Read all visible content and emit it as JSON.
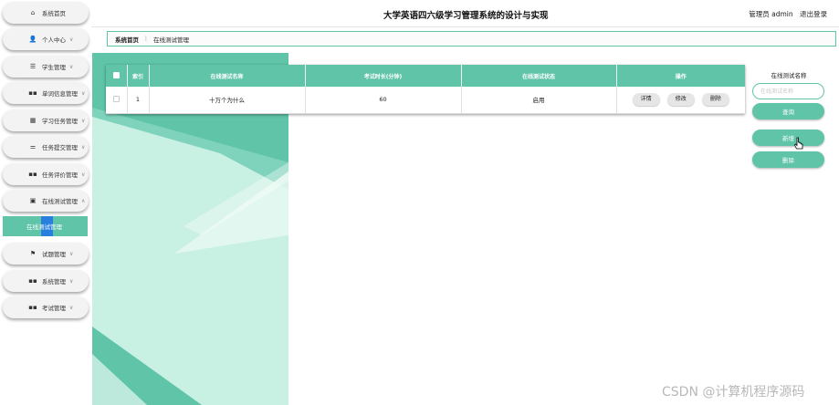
{
  "header": {
    "title": "大学英语四六级学习管理系统的设计与实现",
    "user_label": "管理员 admin",
    "logout_label": "退出登录"
  },
  "sidebar": {
    "items": [
      {
        "icon": "home-icon",
        "icon_glyph": "⌂",
        "label": "系统首页",
        "chevron": ""
      },
      {
        "icon": "user-icon",
        "icon_glyph": "👤",
        "label": "个人中心",
        "chevron": "∨"
      },
      {
        "icon": "list-icon",
        "icon_glyph": "☰",
        "label": "学生管理",
        "chevron": "∨"
      },
      {
        "icon": "grid-icon",
        "icon_glyph": "▪▪",
        "label": "单词信息管理",
        "chevron": "∨"
      },
      {
        "icon": "table-icon",
        "icon_glyph": "▦",
        "label": "学习任务管理",
        "chevron": "∨"
      },
      {
        "icon": "sliders-icon",
        "icon_glyph": "⚌",
        "label": "任务提交管理",
        "chevron": "∨"
      },
      {
        "icon": "grid-icon",
        "icon_glyph": "▪▪",
        "label": "任务评价管理",
        "chevron": "∨"
      },
      {
        "icon": "clipboard-icon",
        "icon_glyph": "▣",
        "label": "在线测试管理",
        "chevron": "∧"
      },
      {
        "icon": "flag-icon",
        "icon_glyph": "⚑",
        "label": "试题管理",
        "chevron": "∨"
      },
      {
        "icon": "grid-icon",
        "icon_glyph": "▪▪",
        "label": "系统管理",
        "chevron": "∨"
      },
      {
        "icon": "grid-icon",
        "icon_glyph": "▪▪",
        "label": "考试管理",
        "chevron": "∨"
      }
    ],
    "active_sub": "在线测试管理"
  },
  "breadcrumb": {
    "home": "系统首页",
    "separator": "⋮",
    "current": "在线测试管理"
  },
  "table": {
    "columns": [
      "索引",
      "在线测试名称",
      "考试时长(分钟)",
      "在线测试状态",
      "操作"
    ],
    "rows": [
      {
        "index": "1",
        "name": "十万个为什么",
        "duration": "60",
        "status": "启用"
      }
    ],
    "actions": {
      "detail": "详情",
      "edit": "修改",
      "delete": "删除"
    }
  },
  "search_panel": {
    "label": "在线测试名称",
    "placeholder": "在线测试名称",
    "search_button": "查询",
    "add_button": "新增",
    "delete_button": "删除"
  },
  "watermark": "CSDN @计算机程序源码",
  "colors": {
    "accent": "#5fc4a8",
    "selection": "#1e73e8"
  }
}
